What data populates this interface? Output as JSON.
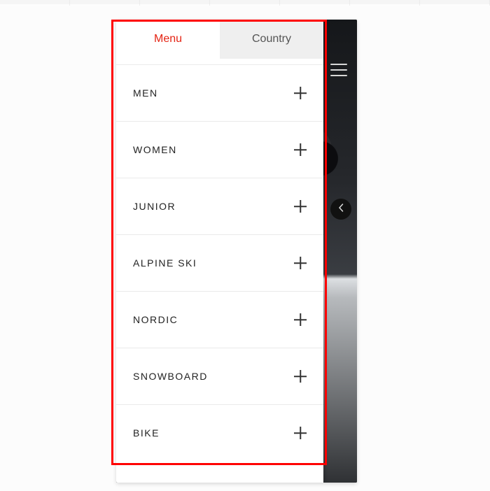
{
  "tabs": {
    "menu": {
      "label": "Menu",
      "active": true
    },
    "country": {
      "label": "Country",
      "active": false
    }
  },
  "menu": {
    "items": [
      {
        "label": "MEN"
      },
      {
        "label": "WOMEN"
      },
      {
        "label": "JUNIOR"
      },
      {
        "label": "ALPINE SKI"
      },
      {
        "label": "NORDIC"
      },
      {
        "label": "SNOWBOARD"
      },
      {
        "label": "BIKE"
      }
    ]
  },
  "icons": {
    "hamburger": "hamburger-icon",
    "carousel_prev": "chevron-left-icon",
    "expand": "plus-icon"
  },
  "colors": {
    "accent": "#e42313",
    "highlight_box": "#ff0000",
    "tab_inactive_bg": "#efefef"
  }
}
